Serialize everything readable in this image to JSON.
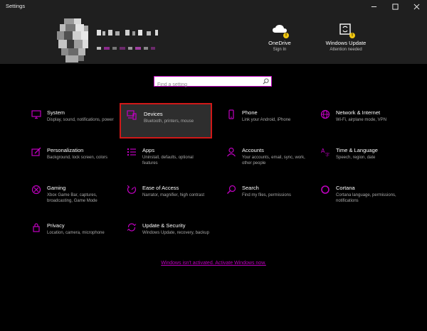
{
  "window": {
    "title": "Settings",
    "controls": {
      "minimize": "minimize",
      "maximize": "maximize",
      "close": "close"
    }
  },
  "header": {
    "onedrive": {
      "label": "OneDrive",
      "sub": "Sign In",
      "badge": "!"
    },
    "windows_update": {
      "label": "Windows Update",
      "sub": "Attention needed",
      "badge": "!"
    }
  },
  "search": {
    "placeholder": "Find a setting"
  },
  "tiles": [
    {
      "name": "System",
      "desc": "Display, sound, notifications, power",
      "icon": "monitor-icon"
    },
    {
      "name": "Devices",
      "desc": "Bluetooth, printers, mouse",
      "icon": "devices-icon"
    },
    {
      "name": "Phone",
      "desc": "Link your Android, iPhone",
      "icon": "phone-icon"
    },
    {
      "name": "Network & Internet",
      "desc": "Wi-Fi, airplane mode, VPN",
      "icon": "globe-icon"
    },
    {
      "name": "Personalization",
      "desc": "Background, lock screen, colors",
      "icon": "paintbrush-icon"
    },
    {
      "name": "Apps",
      "desc": "Uninstall, defaults, optional features",
      "icon": "apps-list-icon"
    },
    {
      "name": "Accounts",
      "desc": "Your accounts, email, sync, work, other people",
      "icon": "person-icon"
    },
    {
      "name": "Time & Language",
      "desc": "Speech, region, date",
      "icon": "time-language-icon"
    },
    {
      "name": "Gaming",
      "desc": "Xbox Game Bar, captures, broadcasting, Game Mode",
      "icon": "xbox-icon"
    },
    {
      "name": "Ease of Access",
      "desc": "Narrator, magnifier, high contrast",
      "icon": "ease-of-access-icon"
    },
    {
      "name": "Search",
      "desc": "Find my files, permissions",
      "icon": "magnifier-icon"
    },
    {
      "name": "Cortana",
      "desc": "Cortana language, permissions, notifications",
      "icon": "cortana-icon"
    },
    {
      "name": "Privacy",
      "desc": "Location, camera, microphone",
      "icon": "lock-icon"
    },
    {
      "name": "Update & Security",
      "desc": "Windows Update, recovery, backup",
      "icon": "sync-arrows-icon"
    }
  ],
  "activation": {
    "text": "Windows isn't activated. Activate Windows now."
  },
  "colors": {
    "accent": "#c000c0",
    "selected_border": "#d01818",
    "header_bg": "#1f1f1f"
  }
}
